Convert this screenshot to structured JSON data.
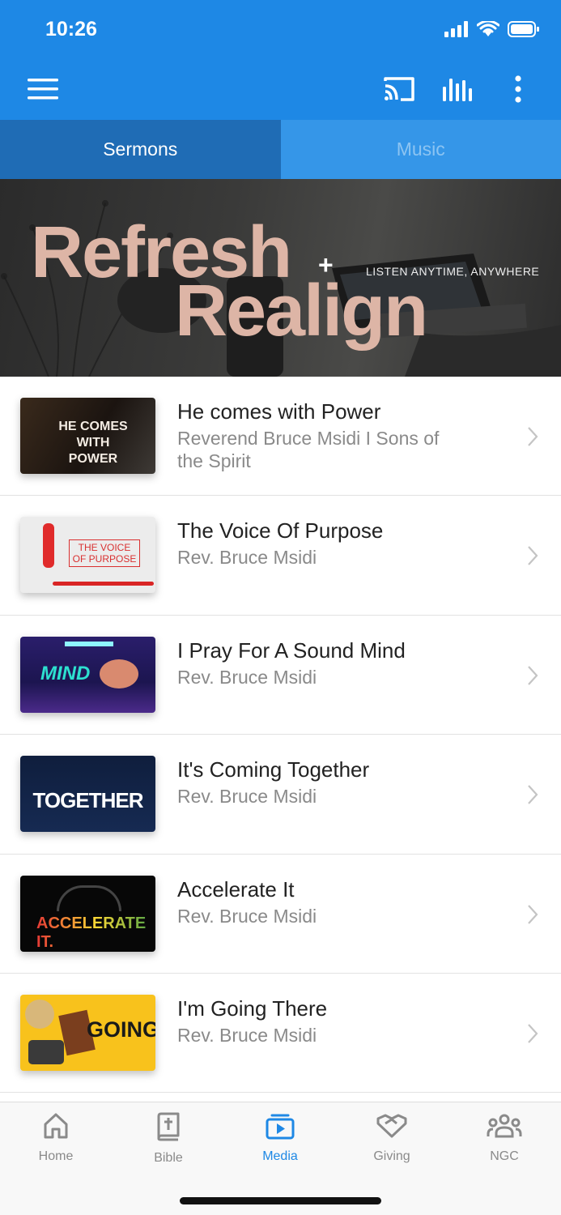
{
  "status": {
    "time": "10:26"
  },
  "appbar": {
    "menu": "menu-icon",
    "cast": "cast-icon",
    "equalizer": "equalizer-icon",
    "more": "more-vert-icon"
  },
  "tabs": [
    {
      "label": "Sermons",
      "active": true
    },
    {
      "label": "Music",
      "active": false
    }
  ],
  "banner": {
    "word1": "Refresh",
    "plus": "+",
    "word2": "Realign",
    "tagline": "LISTEN ANYTIME, ANYWHERE"
  },
  "sermons": [
    {
      "title": "He comes with Power",
      "subtitle": "Reverend Bruce Msidi I Sons of the Spirit",
      "thumb_text": "HE COMES WITH POWER"
    },
    {
      "title": "The Voice Of Purpose",
      "subtitle": "Rev. Bruce Msidi",
      "thumb_text": "THE VOICE OF PURPOSE"
    },
    {
      "title": "I Pray For A Sound Mind",
      "subtitle": "Rev. Bruce Msidi",
      "thumb_text": "MIND"
    },
    {
      "title": "It's Coming Together",
      "subtitle": "Rev. Bruce Msidi",
      "thumb_text": "TOGETHER"
    },
    {
      "title": "Accelerate It",
      "subtitle": "Rev. Bruce Msidi",
      "thumb_text": "ACCELERATE IT."
    },
    {
      "title": "I'm Going There",
      "subtitle": "Rev. Bruce Msidi",
      "thumb_text": "GOING"
    }
  ],
  "bottom_nav": [
    {
      "label": "Home",
      "icon": "home-icon",
      "active": false
    },
    {
      "label": "Bible",
      "icon": "bible-icon",
      "active": false
    },
    {
      "label": "Media",
      "icon": "media-icon",
      "active": true
    },
    {
      "label": "Giving",
      "icon": "giving-icon",
      "active": false
    },
    {
      "label": "NGC",
      "icon": "group-icon",
      "active": false
    }
  ],
  "colors": {
    "primary": "#1e88e5",
    "tab_active": "#1f6cb5",
    "tab_inactive": "#3596e8",
    "banner_text": "#ddb5a6"
  }
}
